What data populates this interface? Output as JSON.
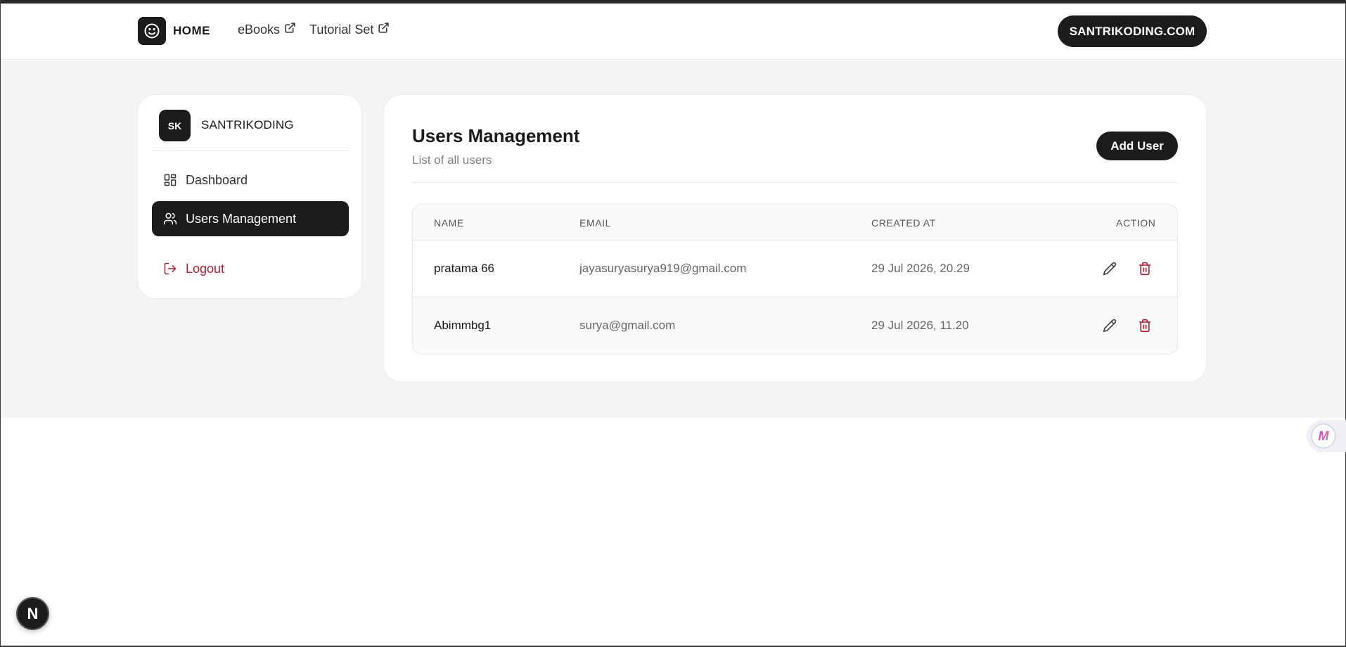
{
  "navbar": {
    "brand_label": "HOME",
    "links": [
      {
        "label": "eBooks"
      },
      {
        "label": "Tutorial Set"
      }
    ],
    "site_button": "SANTRIKODING.COM"
  },
  "sidebar": {
    "avatar_initials": "SK",
    "user_name": "SANTRIKODING",
    "items": [
      {
        "label": "Dashboard",
        "icon": "dashboard-icon"
      },
      {
        "label": "Users Management",
        "icon": "users-icon",
        "active": true
      }
    ],
    "logout_label": "Logout"
  },
  "main": {
    "title": "Users Management",
    "subtitle": "List of all users",
    "add_button": "Add User",
    "table": {
      "headers": [
        "NAME",
        "EMAIL",
        "CREATED AT",
        "ACTION"
      ],
      "rows": [
        {
          "name": "pratama 66",
          "email": "jayasuryasurya919@gmail.com",
          "created_at": "29 Jul 2026, 20.29"
        },
        {
          "name": "Abimmbg1",
          "email": "surya@gmail.com",
          "created_at": "29 Jul 2026, 11.20"
        }
      ]
    }
  },
  "floating": {
    "next_badge_letter": "N",
    "extension_badge_letter": "M"
  },
  "colors": {
    "primary": "#1c1c1c",
    "danger": "#c2182b",
    "background": "#f4f4f4"
  }
}
